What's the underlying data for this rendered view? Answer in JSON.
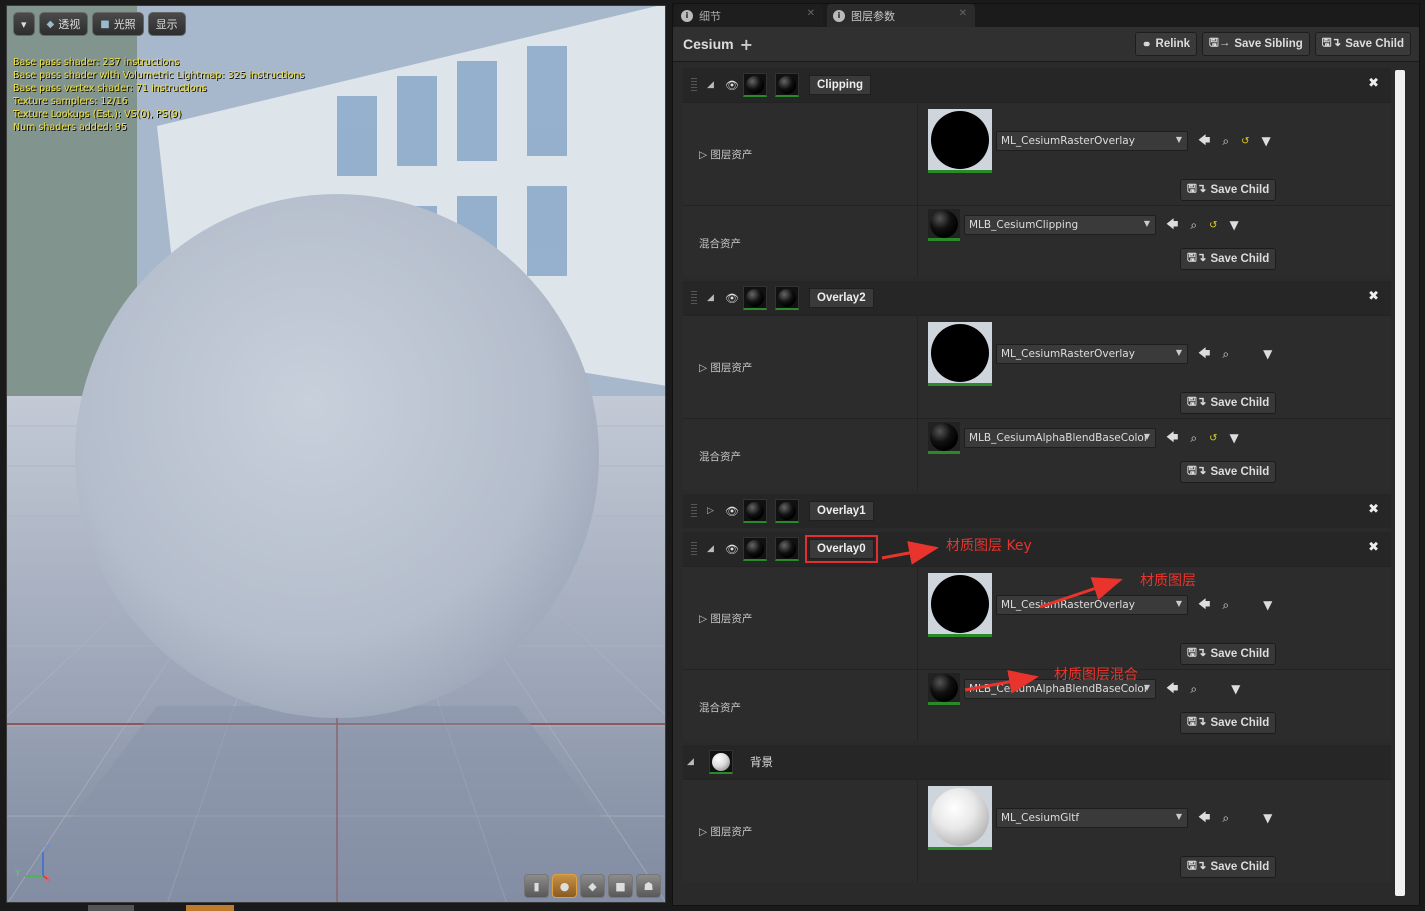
{
  "viewport": {
    "toolbar": {
      "dropdown_icon": "chevron-down-icon",
      "perspective_label": "透视",
      "lit_label": "光照",
      "show_label": "显示"
    },
    "stats": [
      "Base pass shader: 237 instructions",
      "Base pass shader with Volumetric Lightmap: 325 instructions",
      "Base pass vertex shader: 71 instructions",
      "Texture samplers: 12/16",
      "Texture Lookups (Est.): VS(0), PS(9)",
      "Num shaders added: 95"
    ],
    "axis": {
      "z": "Z",
      "y": "Y",
      "x": "X"
    }
  },
  "tabs": [
    {
      "label": "细节",
      "active": false
    },
    {
      "label": "图层参数",
      "active": true
    }
  ],
  "header": {
    "title": "Cesium",
    "relink_label": "Relink",
    "save_sibling_label": "Save Sibling",
    "save_child_label": "Save Child"
  },
  "labels": {
    "layer_asset": "图层资产",
    "blend_asset": "混合资产",
    "save_child": "Save Child"
  },
  "layers": [
    {
      "name": "Clipping",
      "expanded": true,
      "layer_asset": "ML_CesiumRasterOverlay",
      "blend_asset": "MLB_CesiumClipping"
    },
    {
      "name": "Overlay2",
      "expanded": true,
      "layer_asset": "ML_CesiumRasterOverlay",
      "blend_asset": "MLB_CesiumAlphaBlendBaseColor"
    },
    {
      "name": "Overlay1",
      "expanded": false
    },
    {
      "name": "Overlay0",
      "expanded": true,
      "layer_asset": "ML_CesiumRasterOverlay",
      "blend_asset": "MLB_CesiumAlphaBlendBaseColor"
    },
    {
      "name": "背景",
      "expanded": true,
      "layer_asset": "ML_CesiumGltf"
    }
  ],
  "annotations": {
    "key": "材质图层 Key",
    "layer": "材质图层",
    "blend": "材质图层混合"
  },
  "colors": {
    "annotation": "#e8342c",
    "stats_text": "#f0e040",
    "asset_underline": "#2a8a2a"
  }
}
